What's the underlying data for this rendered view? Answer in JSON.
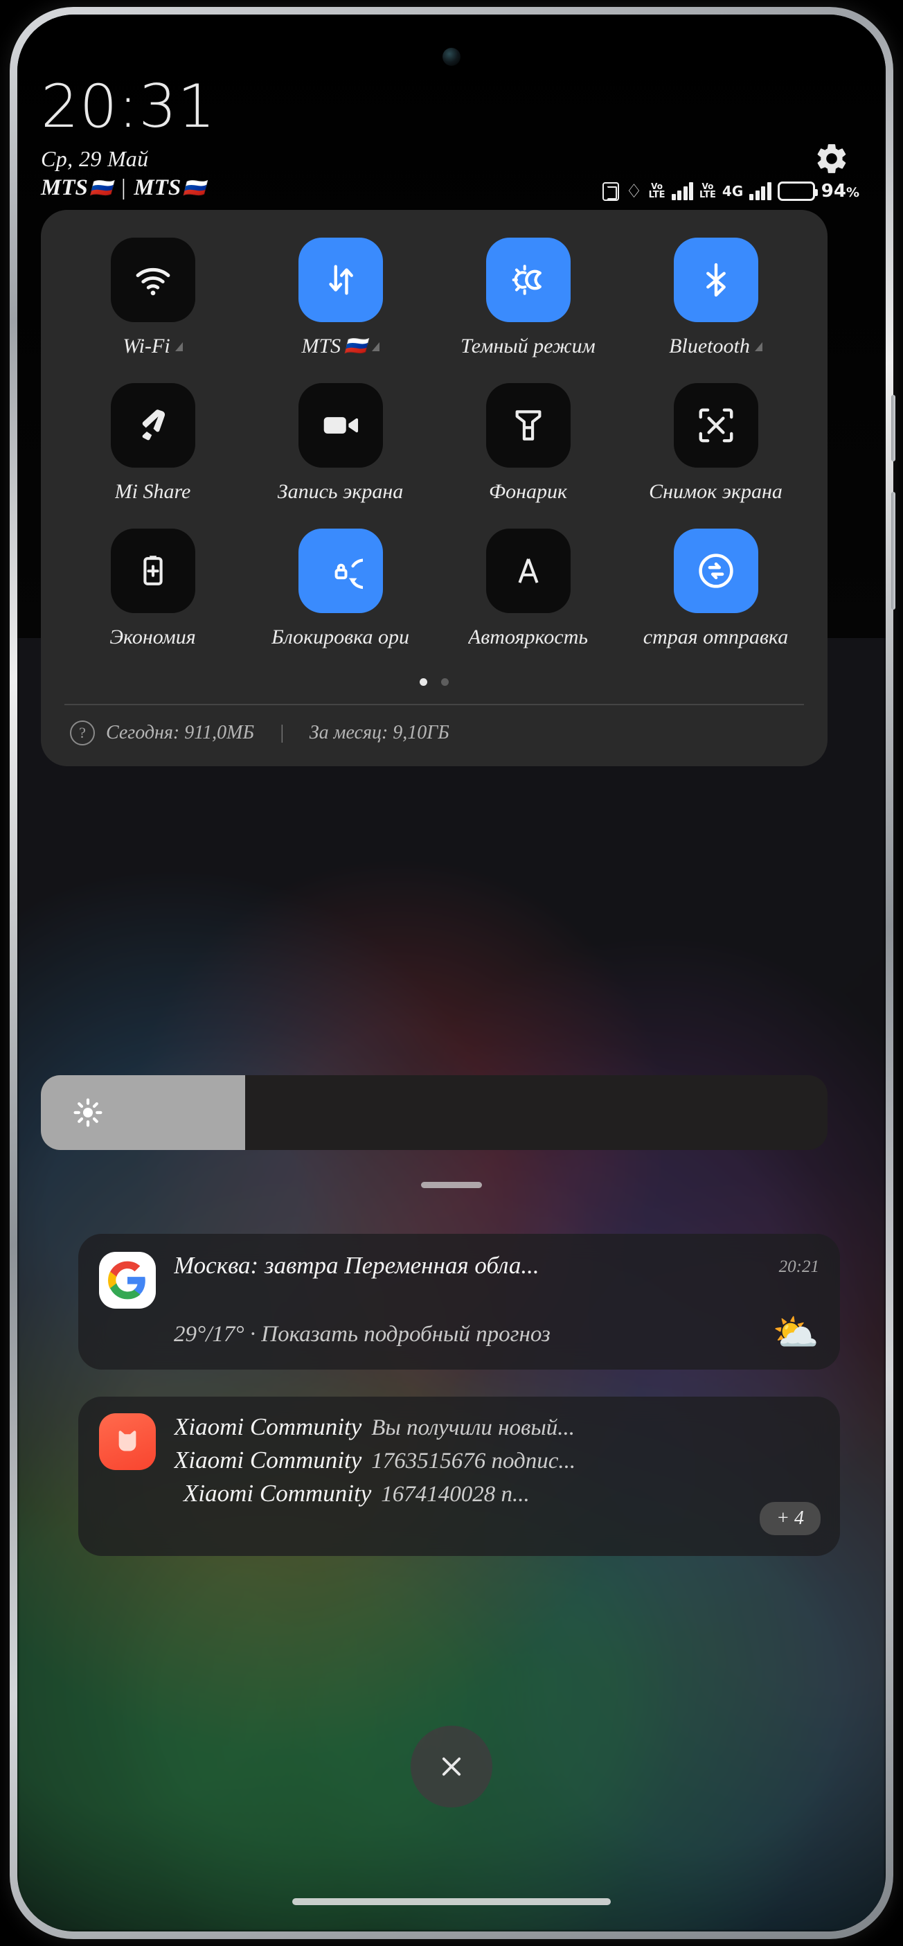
{
  "status_bar": {
    "clock": "20:31",
    "date": "Ср, 29 Май",
    "carrier_1": "MTS",
    "carrier_2": "MTS",
    "carrier_separator": "|",
    "flag": "🇷🇺",
    "battery_percent": "94",
    "battery_unit": "%",
    "nfc": "nfc-icon",
    "bluetooth_glyph": "�remove",
    "volte_top": "Vo",
    "volte_sub": "LTE",
    "network_type": "4G"
  },
  "quick_settings": {
    "tiles": [
      {
        "label": "Wi-Fi",
        "icon": "wifi-icon",
        "active": false,
        "chevron": true
      },
      {
        "label": "MTS",
        "icon": "mobile-data-icon",
        "active": true,
        "chevron": true,
        "flag": "🇷🇺"
      },
      {
        "label": "Темный режим",
        "icon": "dark-mode-icon",
        "active": true,
        "chevron": false
      },
      {
        "label": "Bluetooth",
        "icon": "bluetooth-icon",
        "active": true,
        "chevron": true
      },
      {
        "label": "Mi Share",
        "icon": "mi-share-icon",
        "active": false,
        "chevron": false
      },
      {
        "label": "Запись экрана",
        "icon": "screen-record-icon",
        "active": false,
        "chevron": false
      },
      {
        "label": "Фонарик",
        "icon": "flashlight-icon",
        "active": false,
        "chevron": false
      },
      {
        "label": "Снимок экрана",
        "icon": "screenshot-icon",
        "active": false,
        "chevron": false
      },
      {
        "label": "Экономия",
        "icon": "battery-saver-icon",
        "active": false,
        "chevron": false
      },
      {
        "label": "Блокировка ори",
        "icon": "rotation-lock-icon",
        "active": true,
        "chevron": false
      },
      {
        "label": "Автояркость",
        "icon": "auto-brightness-icon",
        "active": false,
        "chevron": false
      },
      {
        "label": "страя отправка",
        "icon": "quick-share-icon",
        "active": true,
        "chevron": false
      }
    ],
    "pager": {
      "total": 2,
      "active_index": 0
    },
    "data_usage": {
      "help": "?",
      "today": "Сегодня: 911,0МБ",
      "separator": "|",
      "month": "За месяц: 9,10ГБ"
    }
  },
  "brightness": {
    "icon": "brightness-icon",
    "level_percent": 26
  },
  "notifications": [
    {
      "app": "Google",
      "icon": "google-icon",
      "title": "Москва: завтра Переменная обла...",
      "text": "29°/17° · Показать подробный прогноз",
      "time": "20:21",
      "trailing_icon": "⛅"
    }
  ],
  "xiaomi_group": {
    "icon": "xiaomi-community-icon",
    "lines": [
      {
        "app": "Xiaomi Community",
        "message": "Вы получили новый..."
      },
      {
        "app": "Xiaomi Community",
        "message": "1763515676 подпис..."
      },
      {
        "app": "Xiaomi Community",
        "message": "1674140028 n..."
      }
    ],
    "more_badge": "+ 4"
  },
  "actions": {
    "close_label": "close-icon",
    "settings_label": "gear-icon"
  },
  "colors": {
    "accent_blue": "#3a8bfd",
    "tile_off": "#0c0c0c",
    "panel_bg": "#2b2b2b",
    "xiaomi_orange": "#f9452f"
  }
}
